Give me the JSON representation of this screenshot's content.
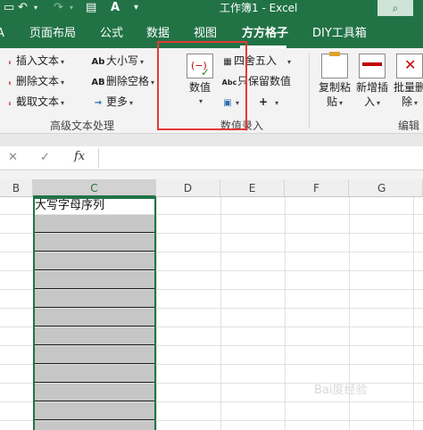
{
  "title_bar": {
    "title": "工作簿1  -  Excel",
    "search_icon": "search-icon"
  },
  "tabs": [
    {
      "label": "页面布局",
      "active": false
    },
    {
      "label": "公式",
      "active": false
    },
    {
      "label": "数据",
      "active": false
    },
    {
      "label": "视图",
      "active": false
    },
    {
      "label": "方方格子",
      "active": true
    },
    {
      "label": "DIY工具箱",
      "active": false
    }
  ],
  "ribbon": {
    "advanced_text": {
      "insert_text": "插入文本",
      "delete_text": "删除文本",
      "cut_text": "截取文本",
      "case": "大小写",
      "delete_spaces": "删除空格",
      "more": "更多",
      "group_label": "高级文本处理"
    },
    "number_entry": {
      "numeric_button": "数值",
      "round": "四舍五入",
      "keep_values": "只保留数值",
      "plus_symbol": "+",
      "group_label": "数值录入"
    },
    "edit": {
      "copy_paste_line1": "复制粘",
      "copy_paste_line2": "贴",
      "insert_line1": "新增插",
      "insert_line2": "入",
      "batch_delete_line1": "批量删",
      "batch_delete_line2": "除",
      "group_label": "编辑"
    }
  },
  "formula_bar": {
    "cancel": "✕",
    "confirm": "✓",
    "fx": "fx",
    "value": ""
  },
  "columns": [
    "B",
    "C",
    "D",
    "E",
    "F",
    "G"
  ],
  "selected_column": "C",
  "cells": {
    "c1": "大写字母序列"
  },
  "watermark": "Bai度经验"
}
